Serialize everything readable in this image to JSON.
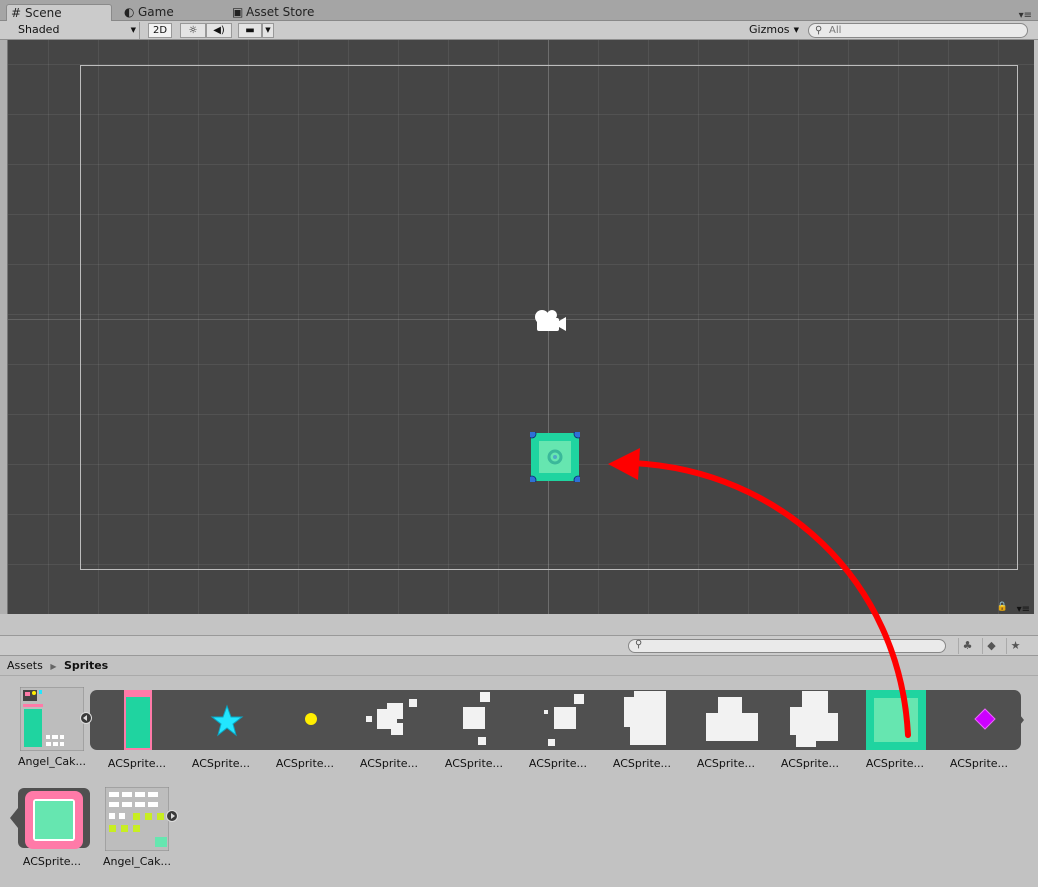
{
  "tabs": {
    "scene": "Scene",
    "game": "Game",
    "asset_store": "Asset Store"
  },
  "toolbar": {
    "shading": "Shaded",
    "mode_2d": "2D",
    "gizmos": "Gizmos",
    "search_placeholder": "All"
  },
  "breadcrumb": {
    "root": "Assets",
    "current": "Sprites"
  },
  "assets": [
    {
      "label": "Angel_Cak..."
    },
    {
      "label": "ACSprite..."
    },
    {
      "label": "ACSprite..."
    },
    {
      "label": "ACSprite..."
    },
    {
      "label": "ACSprite..."
    },
    {
      "label": "ACSprite..."
    },
    {
      "label": "ACSprite..."
    },
    {
      "label": "ACSprite..."
    },
    {
      "label": "ACSprite..."
    },
    {
      "label": "ACSprite..."
    },
    {
      "label": "ACSprite..."
    },
    {
      "label": "ACSprite..."
    },
    {
      "label": "ACSprite..."
    },
    {
      "label": "Angel_Cak..."
    }
  ],
  "colors": {
    "teal": "#1fd4a0",
    "mint": "#66e6b0",
    "pink": "#ff7aa8",
    "arrow": "#ff0000",
    "handle": "#2f6fd6",
    "yellow": "#ffee00",
    "cyan": "#22e6ff",
    "magenta": "#cc00ff"
  }
}
